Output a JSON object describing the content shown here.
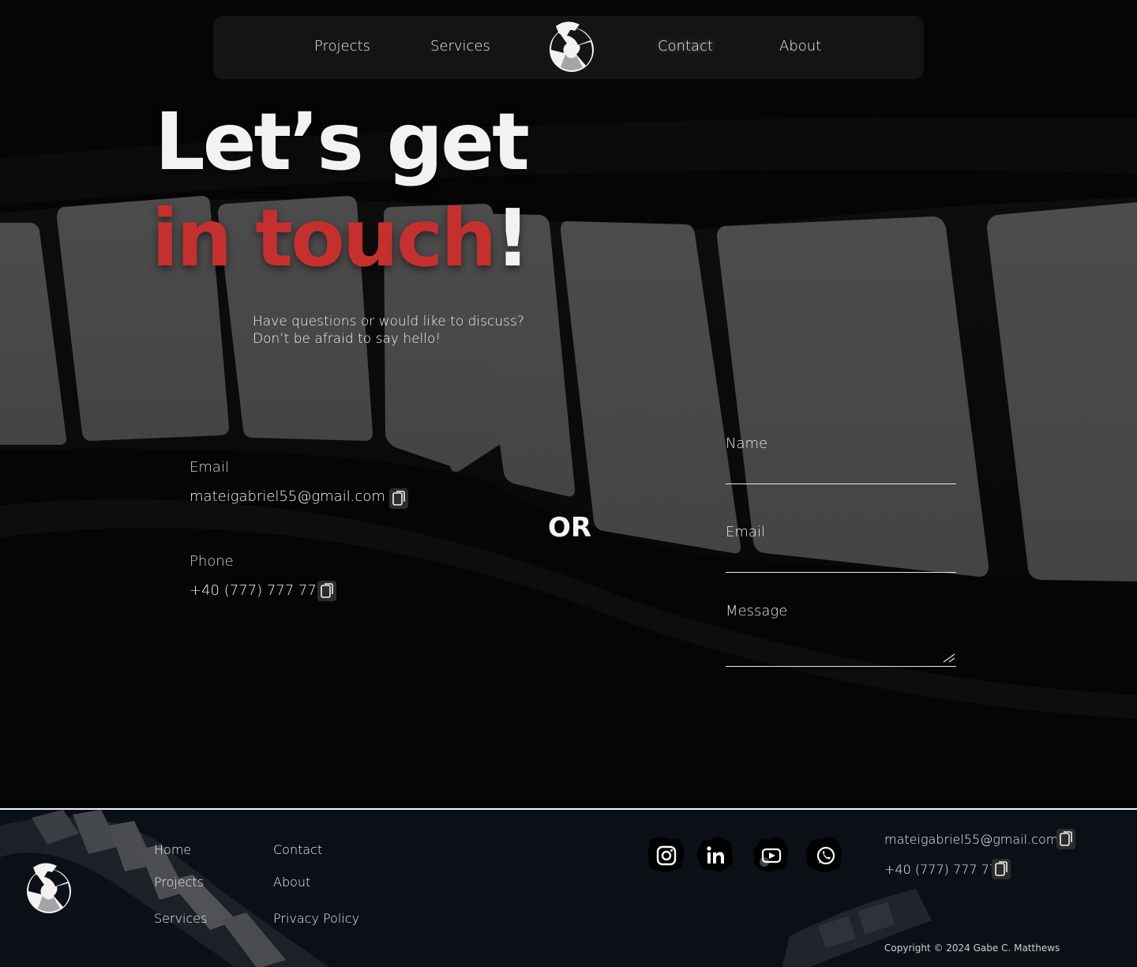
{
  "nav": {
    "links": [
      "Projects",
      "Services",
      "Contact",
      "About"
    ],
    "active": "Contact",
    "logo_icon": "aperture-logo-icon"
  },
  "hero": {
    "line1": "Let’s get",
    "line2_red": "in touch",
    "line2_white": "!",
    "subtitle_line1": "Have questions or would like to discuss?",
    "subtitle_line2": "Don’t be afraid to say hello!"
  },
  "contact_info": {
    "email_label": "Email",
    "email_value": "mateigabriel55@gmail.com",
    "phone_label": "Phone",
    "phone_value": "+40 (777) 777 777",
    "copy_icon": "copy-icon"
  },
  "or_text": "OR",
  "form": {
    "name_label": "Name",
    "email_label": "Email",
    "message_label": "Message"
  },
  "footer": {
    "links_col1": [
      "Home",
      "Projects",
      "Services"
    ],
    "links_col2": [
      "Contact",
      "About",
      "Privacy Policy"
    ],
    "socials": [
      "instagram-icon",
      "linkedin-icon",
      "youtube-icon",
      "whatsapp-icon"
    ],
    "email": "mateigabriel55@gmail.com",
    "phone": "+40 (777) 777 777",
    "copyright": "Copyright © 2024 Gabe C. Matthews"
  },
  "colors": {
    "accent_red": "#c5302f",
    "background": "#050505",
    "footer_bg": "#0b1016"
  }
}
